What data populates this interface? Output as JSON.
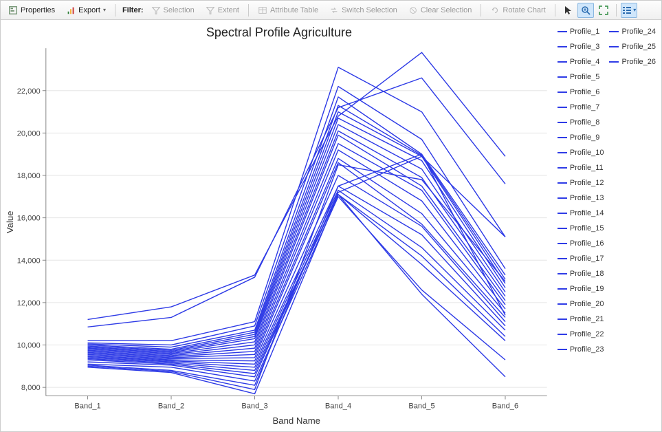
{
  "toolbar": {
    "properties": "Properties",
    "export": "Export",
    "filter_label": "Filter:",
    "selection": "Selection",
    "extent": "Extent",
    "attribute_table": "Attribute Table",
    "switch_selection": "Switch Selection",
    "clear_selection": "Clear Selection",
    "rotate_chart": "Rotate Chart"
  },
  "chart_title": "Spectral Profile Agriculture",
  "xlabel": "Band Name",
  "ylabel": "Value",
  "legend": {
    "col1": [
      "Profile_1",
      "Profile_3",
      "Profile_4",
      "Profile_5",
      "Profile_6",
      "Profile_7",
      "Profile_8",
      "Profile_9",
      "Profile_10",
      "Profile_11",
      "Profile_12",
      "Profile_13",
      "Profile_14",
      "Profile_15",
      "Profile_16",
      "Profile_17",
      "Profile_18",
      "Profile_19",
      "Profile_20",
      "Profile_21",
      "Profile_22",
      "Profile_23"
    ],
    "col2": [
      "Profile_24",
      "Profile_25",
      "Profile_26"
    ]
  },
  "chart_data": {
    "type": "line",
    "title": "Spectral Profile Agriculture",
    "xlabel": "Band Name",
    "ylabel": "Value",
    "ylim": [
      7600,
      24000
    ],
    "yticks": [
      8000,
      10000,
      12000,
      14000,
      16000,
      18000,
      20000,
      22000
    ],
    "ytick_labels": [
      "8,000",
      "10,000",
      "12,000",
      "14,000",
      "16,000",
      "18,000",
      "20,000",
      "22,000"
    ],
    "categories": [
      "Band_1",
      "Band_2",
      "Band_3",
      "Band_4",
      "Band_5",
      "Band_6"
    ],
    "series": [
      {
        "name": "Profile_1",
        "values": [
          11200,
          11800,
          13300,
          20800,
          23800,
          18900
        ]
      },
      {
        "name": "Profile_3",
        "values": [
          10850,
          11300,
          13200,
          21200,
          22600,
          17600
        ]
      },
      {
        "name": "Profile_4",
        "values": [
          10200,
          10200,
          11100,
          23100,
          21000,
          15100
        ]
      },
      {
        "name": "Profile_5",
        "values": [
          10100,
          10000,
          10900,
          22200,
          19700,
          13600
        ]
      },
      {
        "name": "Profile_6",
        "values": [
          10050,
          9900,
          10700,
          21700,
          19000,
          13300
        ]
      },
      {
        "name": "Profile_7",
        "values": [
          10000,
          9800,
          10600,
          21300,
          18950,
          13100
        ]
      },
      {
        "name": "Profile_8",
        "values": [
          9950,
          9750,
          10500,
          21000,
          18900,
          12900
        ]
      },
      {
        "name": "Profile_9",
        "values": [
          9900,
          9700,
          10400,
          20700,
          18700,
          12700
        ]
      },
      {
        "name": "Profile_10",
        "values": [
          9850,
          9650,
          10300,
          20400,
          18300,
          12500
        ]
      },
      {
        "name": "Profile_11",
        "values": [
          9800,
          9600,
          10150,
          20100,
          17900,
          12300
        ]
      },
      {
        "name": "Profile_12",
        "values": [
          9750,
          9550,
          10000,
          19900,
          17500,
          12100
        ]
      },
      {
        "name": "Profile_13",
        "values": [
          9700,
          9500,
          9850,
          19500,
          17300,
          11900
        ]
      },
      {
        "name": "Profile_14",
        "values": [
          9650,
          9450,
          9700,
          19200,
          16800,
          11700
        ]
      },
      {
        "name": "Profile_15",
        "values": [
          9600,
          9400,
          9550,
          18800,
          16200,
          11500
        ]
      },
      {
        "name": "Profile_16",
        "values": [
          9550,
          9350,
          9400,
          18600,
          15700,
          11300
        ]
      },
      {
        "name": "Profile_17",
        "values": [
          9500,
          9300,
          9250,
          18000,
          15600,
          11100
        ]
      },
      {
        "name": "Profile_18",
        "values": [
          9450,
          9250,
          9100,
          17500,
          15200,
          10900
        ]
      },
      {
        "name": "Profile_19",
        "values": [
          9400,
          9200,
          8950,
          17300,
          14600,
          10700
        ]
      },
      {
        "name": "Profile_20",
        "values": [
          9350,
          9150,
          8800,
          17100,
          14200,
          10400
        ]
      },
      {
        "name": "Profile_21",
        "values": [
          9300,
          9100,
          8650,
          17100,
          13800,
          10200
        ]
      },
      {
        "name": "Profile_22",
        "values": [
          9200,
          9050,
          8500,
          17200,
          18900,
          15100
        ]
      },
      {
        "name": "Profile_23",
        "values": [
          9100,
          8950,
          8300,
          17000,
          12600,
          9300
        ]
      },
      {
        "name": "Profile_24",
        "values": [
          9050,
          8800,
          8100,
          17500,
          19000,
          11400
        ]
      },
      {
        "name": "Profile_25",
        "values": [
          9000,
          8750,
          7900,
          18500,
          17800,
          13000
        ]
      },
      {
        "name": "Profile_26",
        "values": [
          8950,
          8700,
          7700,
          17100,
          12400,
          8500
        ]
      }
    ]
  }
}
